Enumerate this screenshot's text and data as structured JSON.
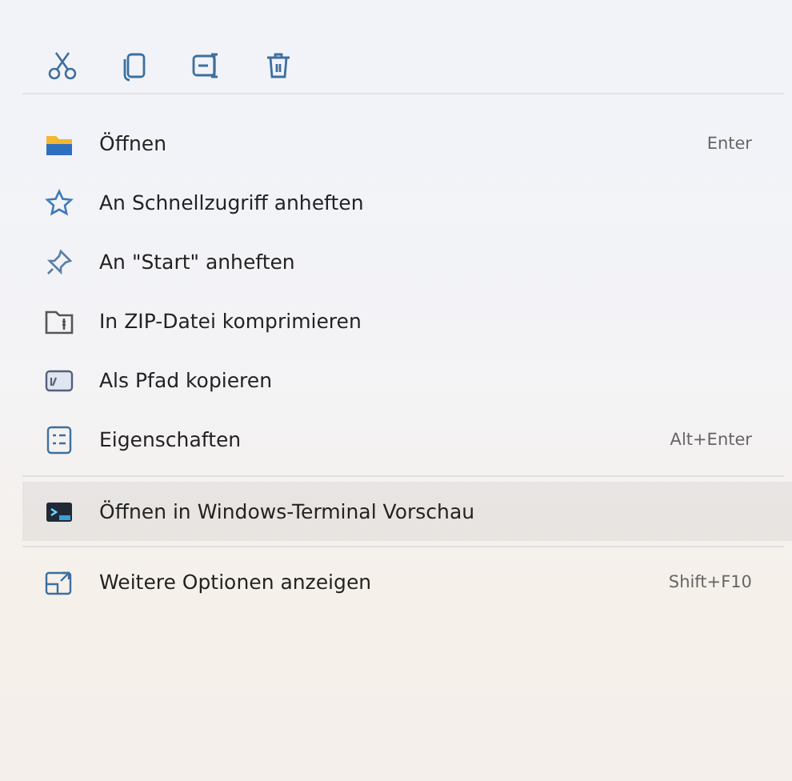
{
  "toolbar": {
    "buttons": [
      {
        "kind": "cut"
      },
      {
        "kind": "copy"
      },
      {
        "kind": "rename"
      },
      {
        "kind": "delete"
      }
    ]
  },
  "groups": [
    {
      "items": [
        {
          "label": "Öffnen",
          "shortcut": "Enter",
          "selected": false
        },
        {
          "label": "An Schnellzugriff anheften",
          "selected": false
        },
        {
          "label": "An \"Start\" anheften",
          "selected": false
        },
        {
          "label": "In ZIP-Datei komprimieren",
          "selected": false
        },
        {
          "label": "Als Pfad kopieren",
          "selected": false
        },
        {
          "label": "Eigenschaften",
          "shortcut": "Alt+Enter",
          "selected": false
        }
      ]
    },
    {
      "items": [
        {
          "label": "Öffnen in Windows-Terminal Vorschau",
          "selected": true
        }
      ]
    },
    {
      "items": [
        {
          "label": "Weitere Optionen anzeigen",
          "shortcut": "Shift+F10",
          "selected": false
        }
      ]
    }
  ]
}
